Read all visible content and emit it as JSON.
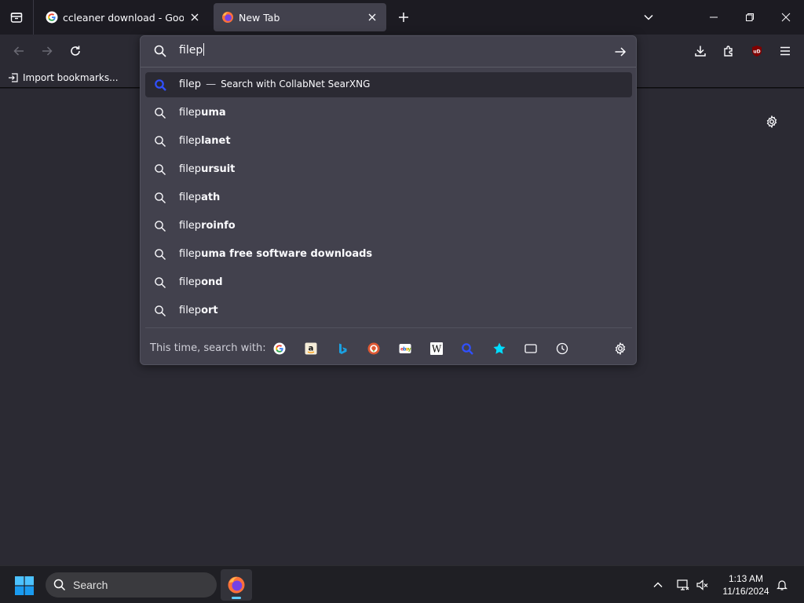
{
  "tabs": [
    {
      "title": "ccleaner download - Google Search",
      "favicon": "google-icon",
      "active": false
    },
    {
      "title": "New Tab",
      "favicon": "firefox-icon",
      "active": true
    }
  ],
  "bookmarks": {
    "items": [
      {
        "label": "Import bookmarks..."
      }
    ]
  },
  "urlbar": {
    "typed": "filep",
    "heuristic": {
      "text": "filep",
      "dash": "—",
      "action": "Search with CollabNet SearXNG"
    },
    "suggestions": [
      {
        "prefix": "filep",
        "suffix": "uma"
      },
      {
        "prefix": "filep",
        "suffix": "lanet"
      },
      {
        "prefix": "filep",
        "suffix": "ursuit"
      },
      {
        "prefix": "filep",
        "suffix": "ath"
      },
      {
        "prefix": "filep",
        "suffix": "roinfo"
      },
      {
        "prefix": "filep",
        "suffix": "uma free software downloads"
      },
      {
        "prefix": "filep",
        "suffix": "ond"
      },
      {
        "prefix": "filep",
        "suffix": "ort"
      }
    ],
    "oneoff_label": "This time, search with:",
    "oneoff_engines": [
      "google-icon",
      "amazon-icon",
      "bing-icon",
      "duckduckgo-icon",
      "ebay-icon",
      "wikipedia-icon",
      "searxng-icon",
      "bookmarks-icon",
      "tabs-icon",
      "history-icon"
    ]
  },
  "taskbar": {
    "search_label": "Search",
    "time": "1:13 AM",
    "date": "11/16/2024"
  },
  "colors": {
    "accent_blue": "#0060df",
    "searxng_blue": "#3050ff",
    "firefox_orange": "#ff7139",
    "windows_blue": "#60cdff"
  }
}
